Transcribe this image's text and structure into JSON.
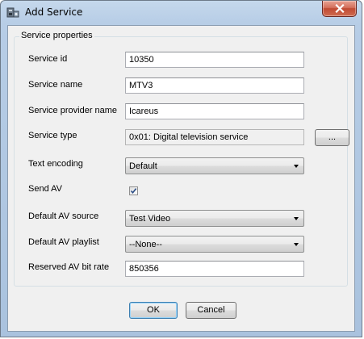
{
  "window": {
    "title": "Add Service"
  },
  "group": {
    "legend": "Service properties"
  },
  "fields": {
    "service_id": {
      "label": "Service id",
      "value": "10350"
    },
    "service_name": {
      "label": "Service name",
      "value": "MTV3"
    },
    "service_provider_name": {
      "label": "Service provider name",
      "value": "Icareus"
    },
    "service_type": {
      "label": "Service type",
      "value": "0x01: Digital television service",
      "browse_label": "..."
    },
    "text_encoding": {
      "label": "Text encoding",
      "selected": "Default"
    },
    "send_av": {
      "label": "Send AV",
      "checked": true
    },
    "default_av_source": {
      "label": "Default AV source",
      "selected": "Test Video"
    },
    "default_av_playlist": {
      "label": "Default AV playlist",
      "selected": "--None--"
    },
    "reserved_av_bit_rate": {
      "label": "Reserved AV bit rate",
      "value": "850356"
    }
  },
  "buttons": {
    "ok_label": "OK",
    "cancel_label": "Cancel"
  },
  "icons": {
    "window": "app-icon",
    "close": "close-icon",
    "checkmark": "checkmark-icon",
    "dropdown": "chevron-down-icon"
  }
}
